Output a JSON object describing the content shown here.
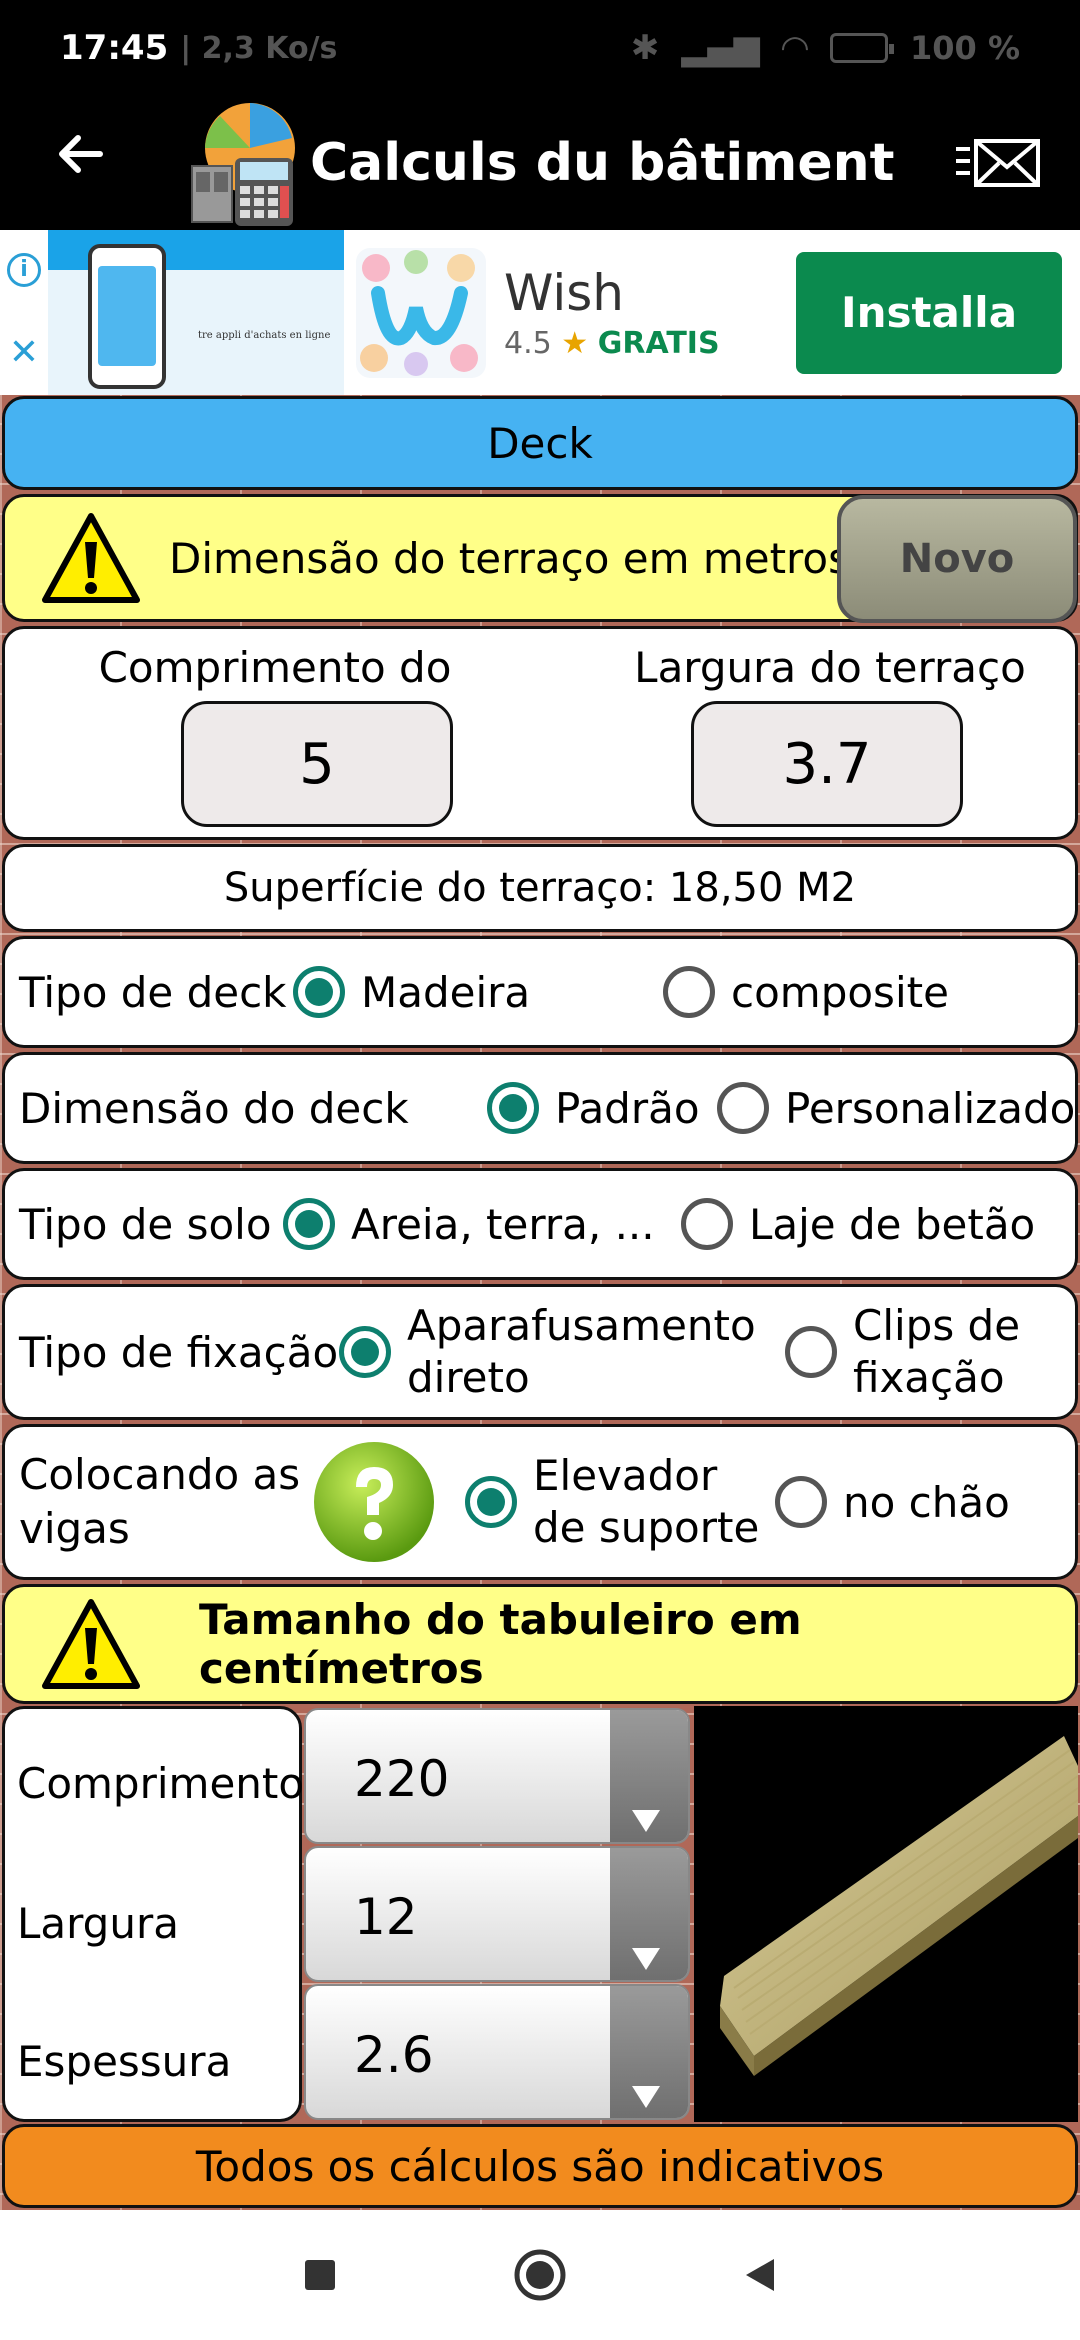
{
  "status": {
    "time": "17:45",
    "net": "| 2,3 Ko/s",
    "battery": "100 %"
  },
  "appbar": {
    "title": "Calculs du bâtiment"
  },
  "ad": {
    "tagline": "tre appli d'achats en ligne",
    "app_name": "Wish",
    "rating": "4.5",
    "price": "GRATIS",
    "install_label": "Installa"
  },
  "deck": {
    "header": "Deck"
  },
  "dimension": {
    "label": "Dimensão do terraço em metros",
    "novo_label": "Novo",
    "length_label": "Comprimento do terraço",
    "length_value": "5",
    "width_label": "Largura do terraço",
    "width_value": "3.7",
    "surface": "Superfície do terraço: 18,50 M2"
  },
  "options": {
    "deck_type": {
      "label": "Tipo de deck",
      "opt1": "Madeira",
      "opt2": "composite"
    },
    "deck_dim": {
      "label": "Dimensão do deck",
      "opt1": "Padrão",
      "opt2": "Personalizado"
    },
    "soil": {
      "label": "Tipo de solo",
      "opt1": "Areia, terra, ...",
      "opt2": "Laje de betão"
    },
    "fix": {
      "label1": "Tipo de fixação",
      "opt1a": "Aparafusamento",
      "opt1b": "direto",
      "opt2a": "Clips de",
      "opt2b": "fixação"
    },
    "joists": {
      "label1": "Colocando as",
      "label2": "vigas",
      "opt1a": "Elevador",
      "opt1b": "de suporte",
      "opt2": "no chão"
    }
  },
  "board": {
    "header": "Tamanho do tabuleiro em centímetros",
    "length_label": "Comprimento",
    "length_value": "220",
    "width_label": "Largura",
    "width_value": "12",
    "thickness_label": "Espessura",
    "thickness_value": "2.6"
  },
  "footer": {
    "note": "Todos os cálculos são indicativos"
  },
  "colors": {
    "deck_header": "#46b2f2",
    "warning_bg": "#ffff88",
    "footer_bg": "#f28b1e",
    "radio_accent": "#0d7f6e",
    "install_bg": "#0b8a4e"
  }
}
